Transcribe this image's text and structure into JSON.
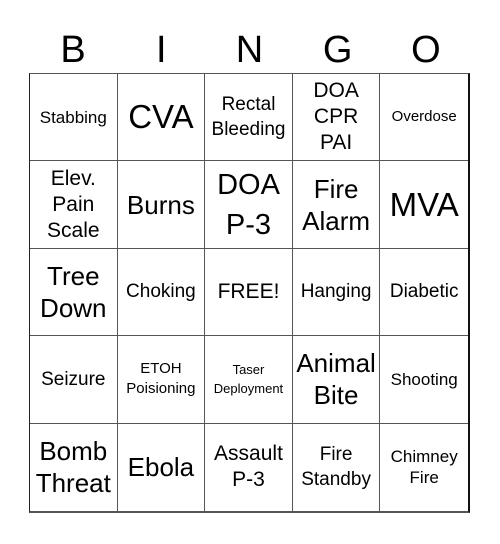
{
  "header": {
    "letters": [
      "B",
      "I",
      "N",
      "G",
      "O"
    ]
  },
  "card": {
    "cells": [
      "Stabbing",
      "CVA",
      "Rectal\nBleeding",
      "DOA\nCPR\nPAI",
      "Overdose",
      "Elev.\nPain\nScale",
      "Burns",
      "DOA\nP-3",
      "Fire\nAlarm",
      "MVA",
      "Tree\nDown",
      "Choking",
      "FREE!",
      "Hanging",
      "Diabetic",
      "Seizure",
      "ETOH\nPoisioning",
      "Taser\nDeployment",
      "Animal\nBite",
      "Shooting",
      "Bomb\nThreat",
      "Ebola",
      "Assault\nP-3",
      "Fire\nStandby",
      "Chimney\nFire"
    ]
  }
}
